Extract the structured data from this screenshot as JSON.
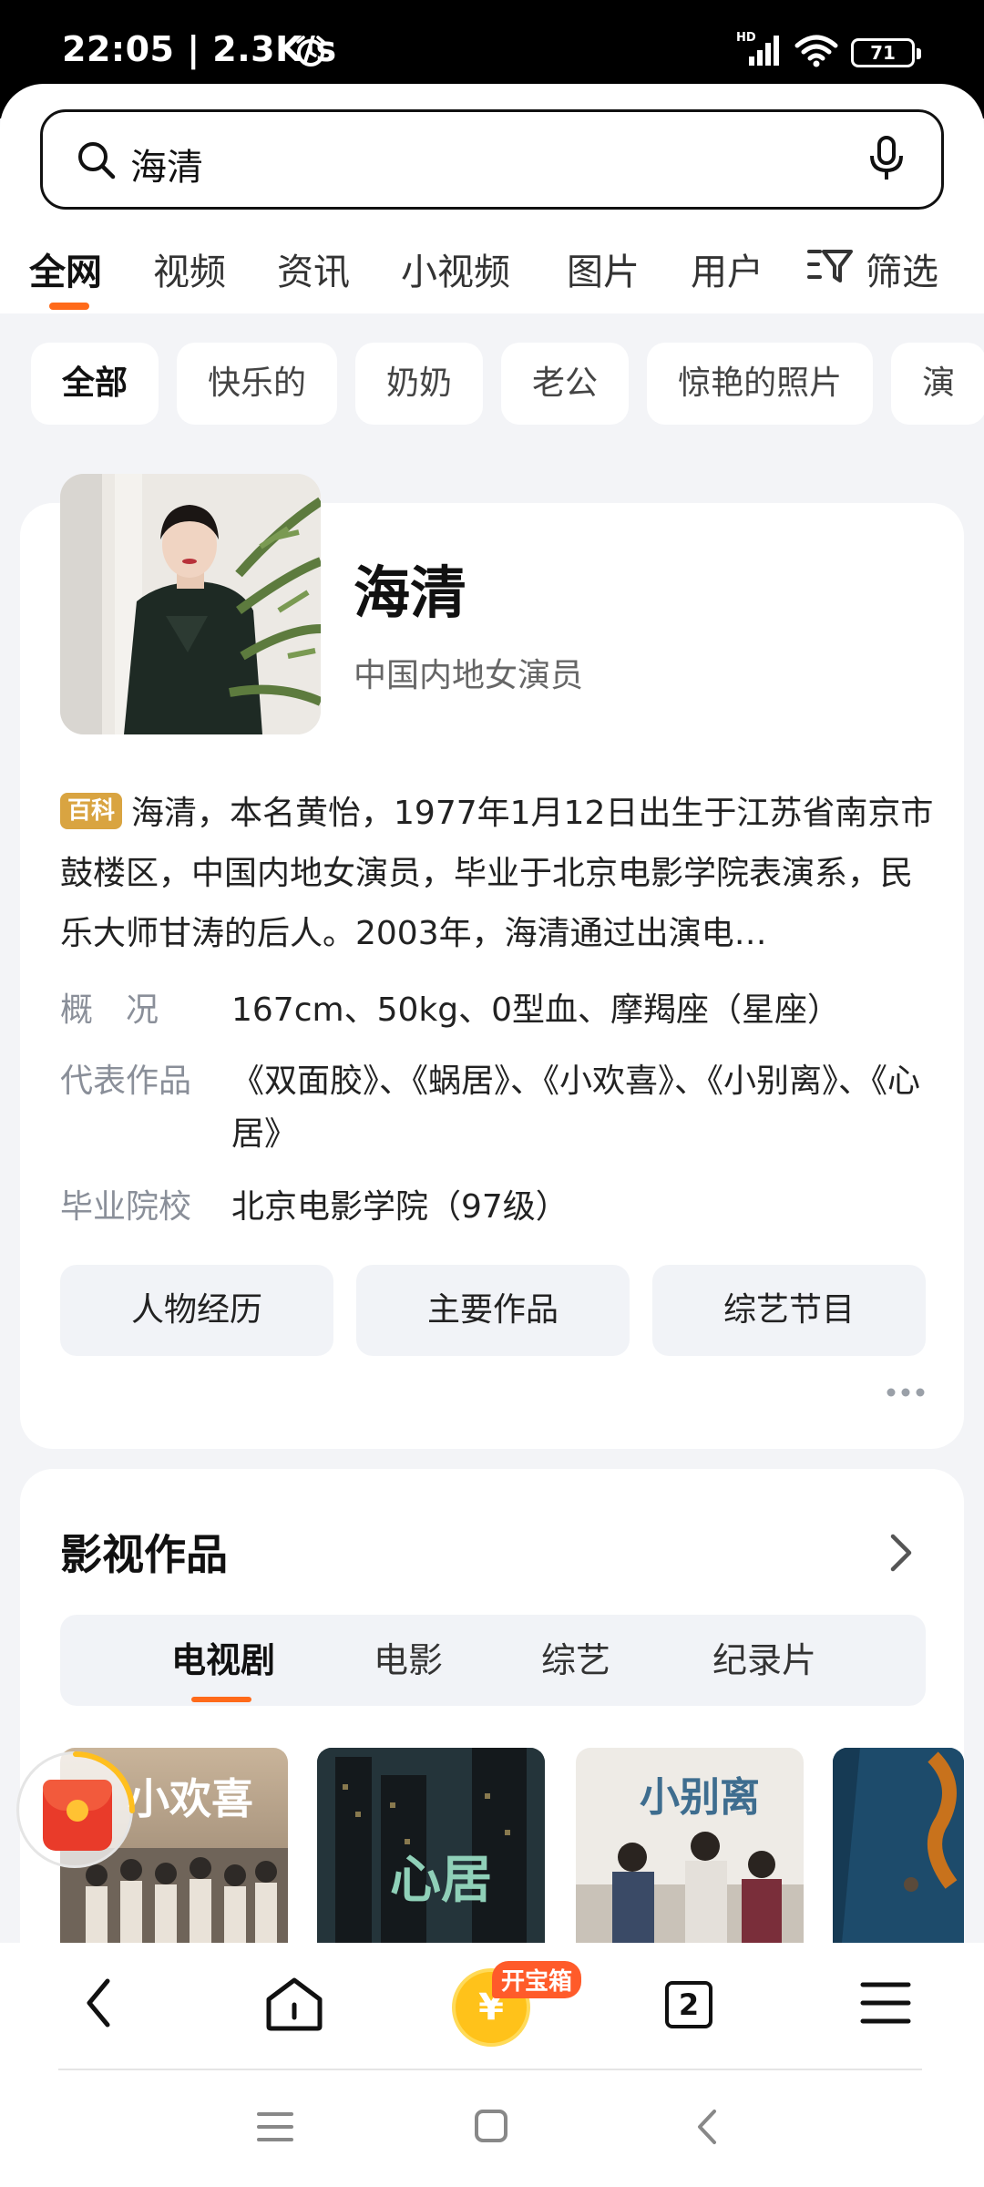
{
  "status_bar": {
    "time": "22:05 | 2.3K/s",
    "battery": "71",
    "network": "HD"
  },
  "search": {
    "query": "海清"
  },
  "tabs": [
    {
      "label": "全网",
      "active": true
    },
    {
      "label": "视频"
    },
    {
      "label": "资讯"
    },
    {
      "label": "小视频"
    },
    {
      "label": "图片"
    },
    {
      "label": "用户"
    }
  ],
  "filter_label": "筛选",
  "chips": [
    "全部",
    "快乐的",
    "奶奶",
    "老公",
    "惊艳的照片",
    "演"
  ],
  "profile": {
    "name": "海清",
    "subtitle": "中国内地女演员",
    "baike_badge": "百科",
    "intro": "海清，本名黄怡，1977年1月12日出生于江苏省南京市鼓楼区，中国内地女演员，毕业于北京电影学院表演系，民乐大师甘涛的后人。2003年，海清通过出演电…",
    "facts": [
      {
        "key": "概　况",
        "value": "167cm、50kg、0型血、摩羯座（星座）"
      },
      {
        "key": "代表作品",
        "value": "《双面胶》、《蜗居》、《小欢喜》、《小别离》、《心居》"
      },
      {
        "key": "毕业院校",
        "value": "北京电影学院（97级）"
      }
    ],
    "buttons": [
      "人物经历",
      "主要作品",
      "综艺节目"
    ]
  },
  "works": {
    "title": "影视作品",
    "tabs": [
      "电视剧",
      "电影",
      "综艺",
      "纪录片"
    ],
    "posters": [
      {
        "title": "小欢喜"
      },
      {
        "title": "心居"
      },
      {
        "title": "小别离"
      },
      {
        "title": ""
      }
    ]
  },
  "bottom_nav": {
    "treasure_badge": "开宝箱",
    "treasure_symbol": "¥",
    "tab_count": "2"
  },
  "colors": {
    "accent": "#ff6a1a",
    "baike": "#d9a441",
    "redpacket": "#e93b2a"
  }
}
